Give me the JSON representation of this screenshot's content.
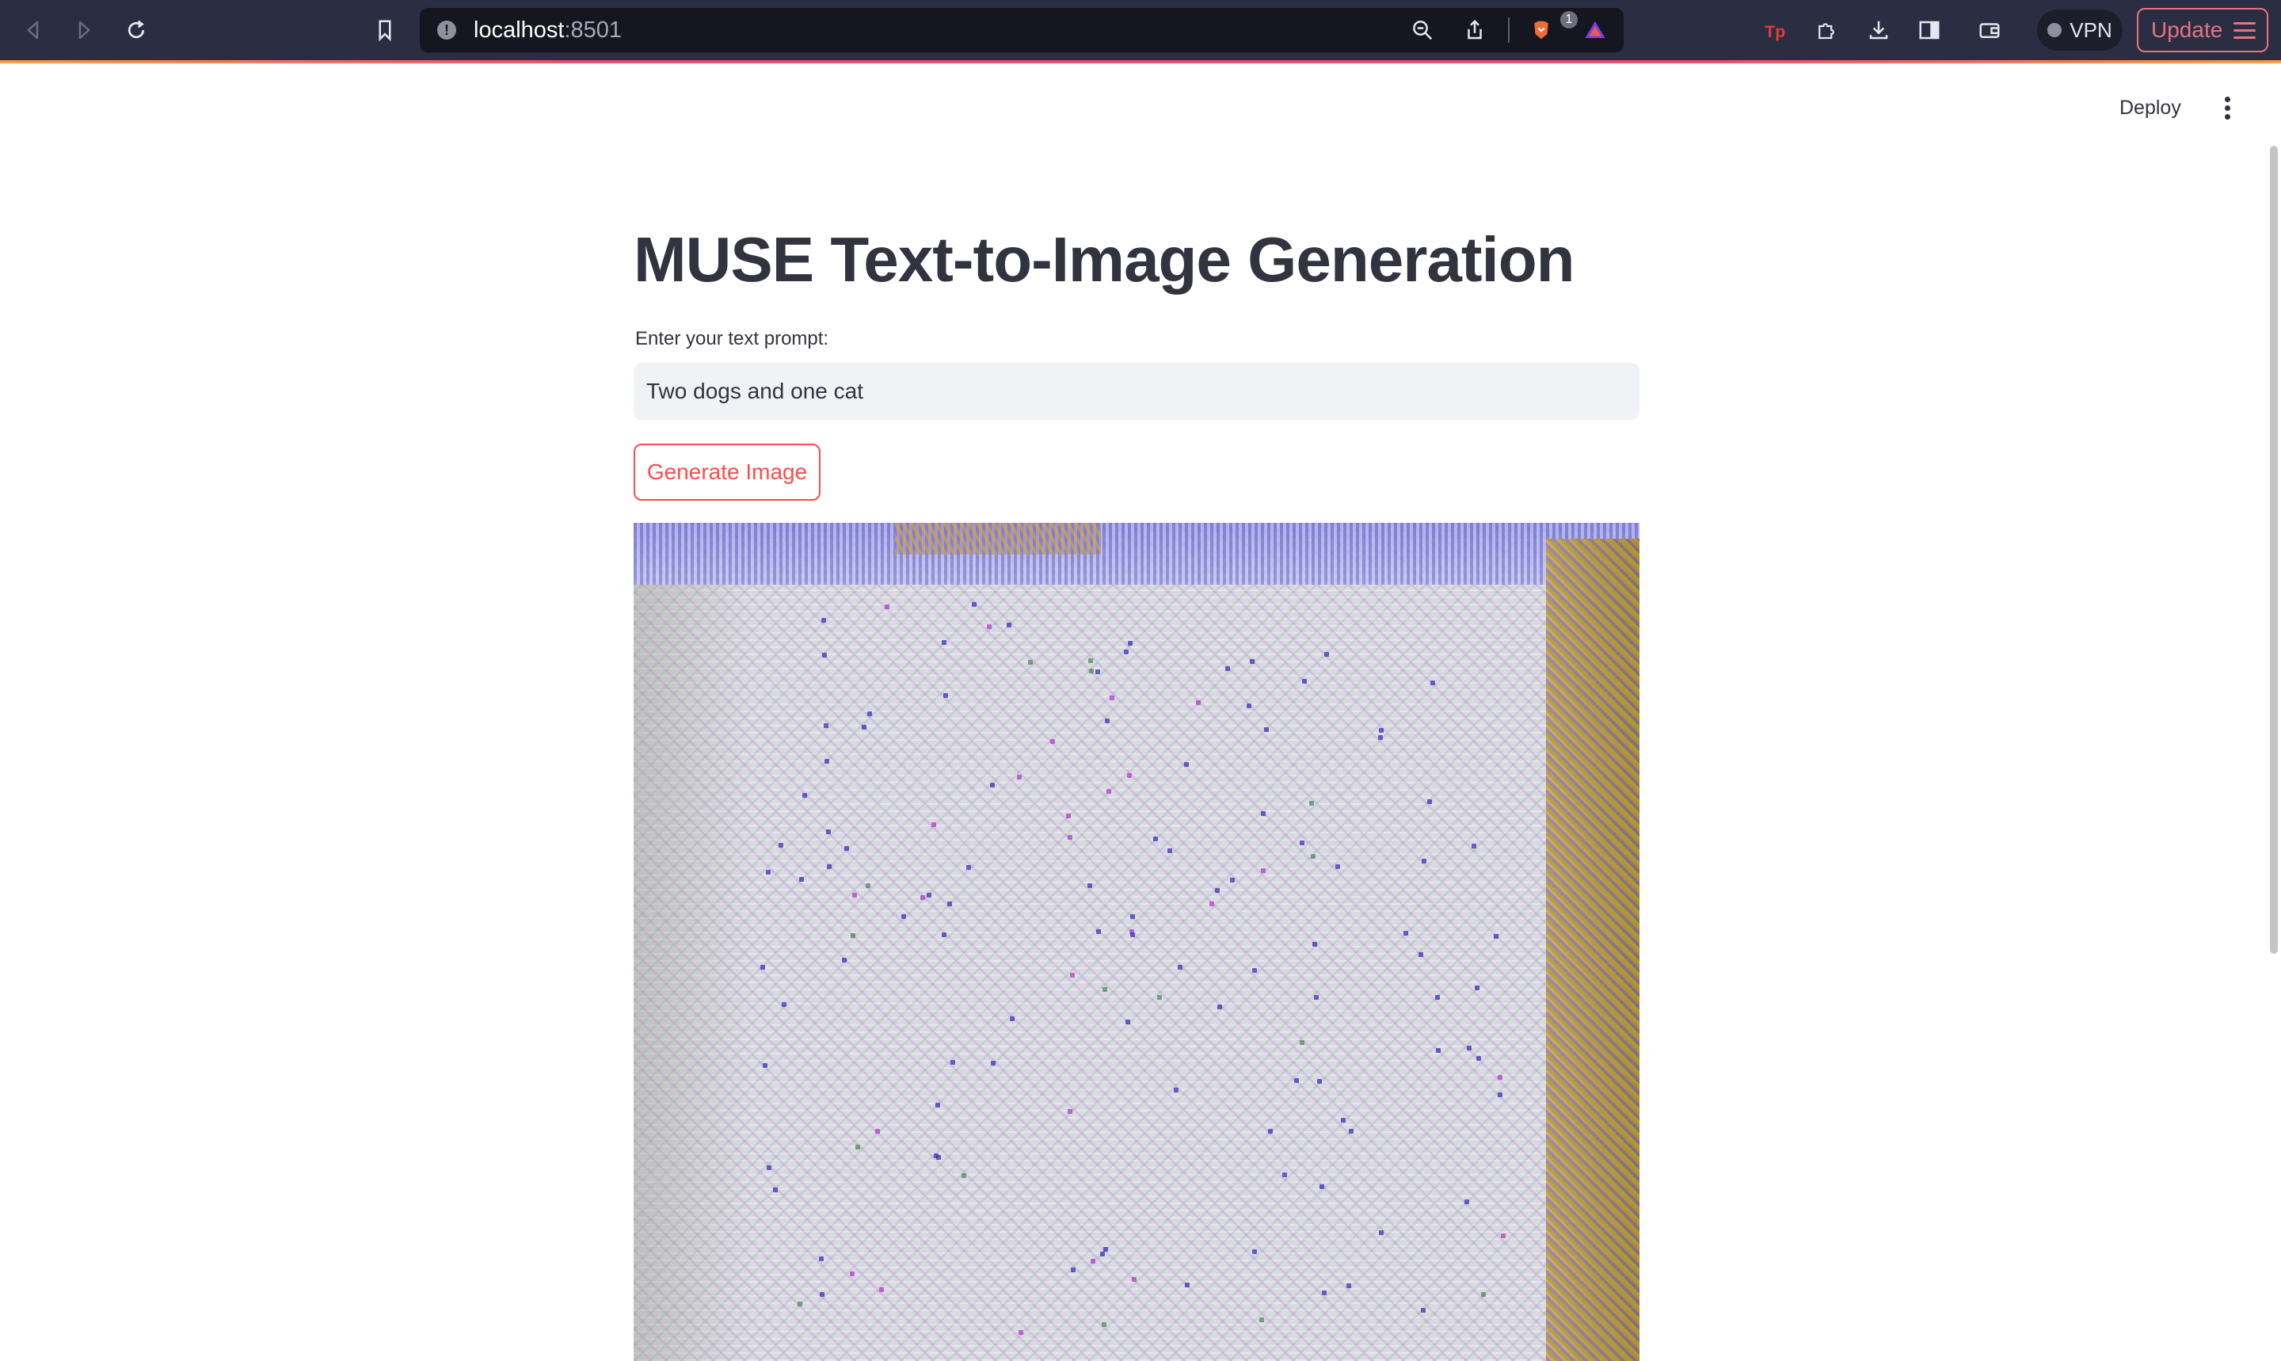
{
  "browser": {
    "url_host": "localhost",
    "url_port": ":8501",
    "shield_badge_count": "1",
    "vpn_label": "VPN",
    "update_label": "Update",
    "accent_color": "#e5757f"
  },
  "app": {
    "deploy_label": "Deploy",
    "title": "MUSE Text-to-Image Generation",
    "prompt_label": "Enter your text prompt:",
    "prompt_value": "Two dogs and one cat",
    "generate_button_label": "Generate Image",
    "primary_color": "#ff4b4b",
    "text_color": "#31333f"
  }
}
